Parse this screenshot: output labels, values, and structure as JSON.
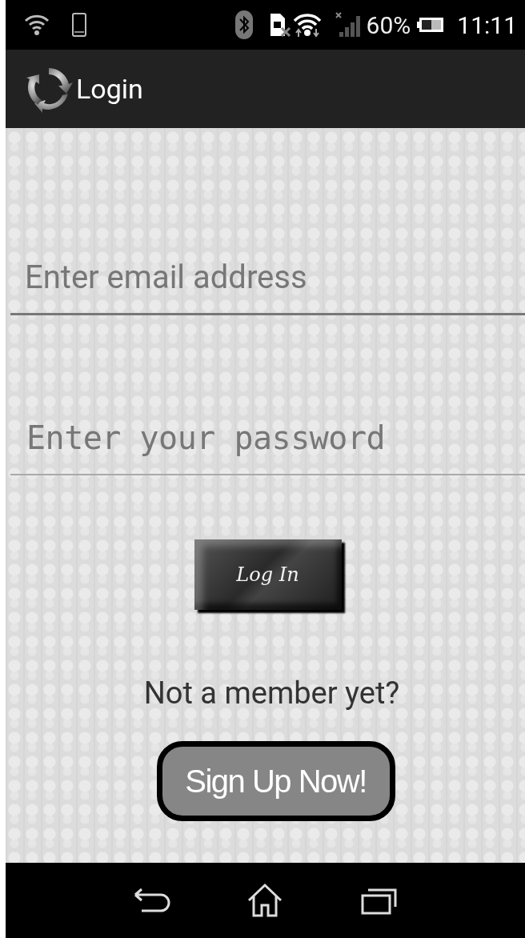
{
  "status_bar": {
    "battery": "60%",
    "time": "11:11"
  },
  "app_bar": {
    "title": "Login"
  },
  "email_field": {
    "placeholder": "Enter email address"
  },
  "password_field": {
    "placeholder": "Enter your password"
  },
  "login_button": {
    "label": "Log In"
  },
  "signup_prompt": "Not a member yet?",
  "signup_button": {
    "label": "Sign Up Now!"
  }
}
